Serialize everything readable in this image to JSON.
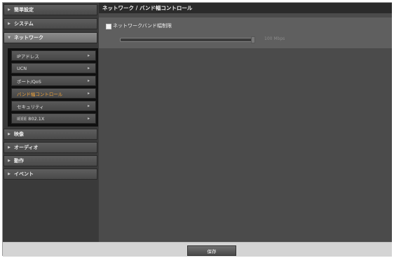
{
  "sidebar": {
    "items": [
      {
        "label": "簡単設定"
      },
      {
        "label": "システム"
      },
      {
        "label": "ネットワーク"
      },
      {
        "label": "映像"
      },
      {
        "label": "オーディオ"
      },
      {
        "label": "動作"
      },
      {
        "label": "イベント"
      }
    ],
    "network_submenu": [
      {
        "label": "IPアドレス"
      },
      {
        "label": "UCN"
      },
      {
        "label": "ポート/QoS"
      },
      {
        "label": "バンド幅コントロール"
      },
      {
        "label": "セキュリティ"
      },
      {
        "label": "IEEE 802.1X"
      }
    ],
    "active_submenu": "バンド幅コントロール"
  },
  "content": {
    "title": "ネットワーク / バンド幅コントロール",
    "bandwidth_limit_label": "ネットワークバンド幅制限",
    "bandwidth_limit_checked": false,
    "slider_value_text": "100 Mbps"
  },
  "footer": {
    "save_label": "保存"
  },
  "colors": {
    "active_item": "#f0a33a",
    "background": "#3c3c3c",
    "footer": "#d4d4d4"
  }
}
